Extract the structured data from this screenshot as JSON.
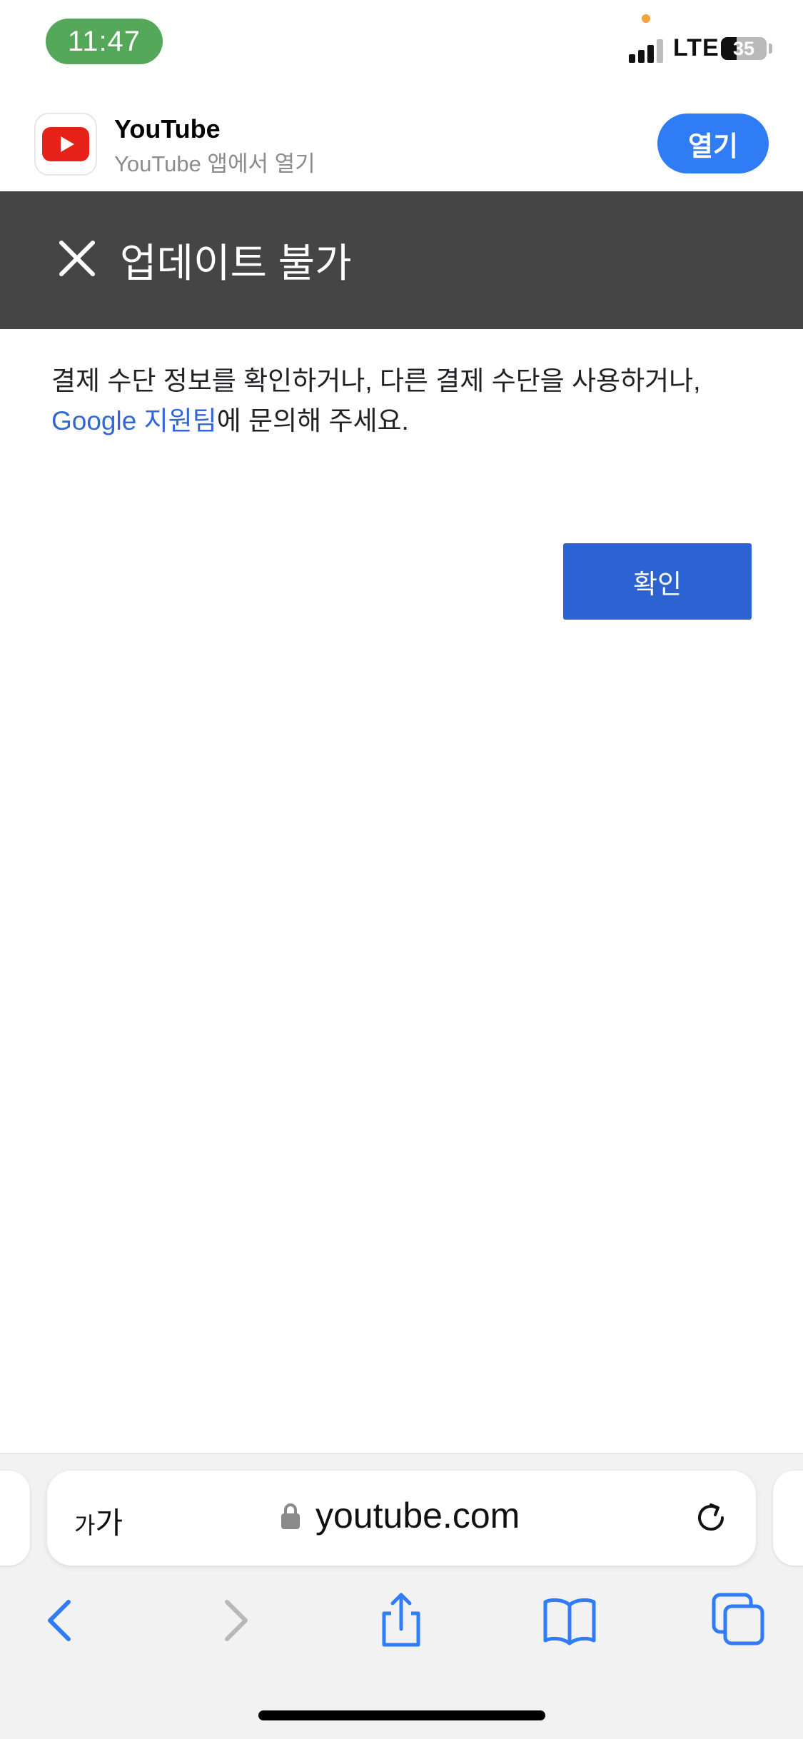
{
  "status_bar": {
    "time": "11:47",
    "network": "LTE",
    "battery_percent": 35,
    "battery_label": "35"
  },
  "app_banner": {
    "app_name": "YouTube",
    "subtitle": "YouTube 앱에서 열기",
    "open_label": "열기"
  },
  "dialog": {
    "title": "업데이트 불가",
    "message_prefix": "결제 수단 정보를 확인하거나, 다른 결제 수단을 사용하거나,",
    "link_text": "Google 지원팀",
    "message_suffix": "에 문의해 주세요.",
    "confirm_label": "확인"
  },
  "browser": {
    "text_size_label_small": "가",
    "text_size_label_large": "가",
    "url": "youtube.com"
  },
  "colors": {
    "header_bg": "#454545",
    "primary_button": "#2c62d2",
    "link": "#3367d6",
    "open_button": "#2f7cf6",
    "time_pill": "#55a85a",
    "toolbar_icon": "#2f7cf6"
  },
  "icons": {
    "close": "close-icon",
    "youtube": "youtube-logo-icon",
    "lock": "lock-icon",
    "reload": "reload-icon",
    "back": "back-icon",
    "forward": "forward-icon",
    "share": "share-icon",
    "bookmarks": "bookmarks-icon",
    "tabs": "tabs-icon"
  }
}
